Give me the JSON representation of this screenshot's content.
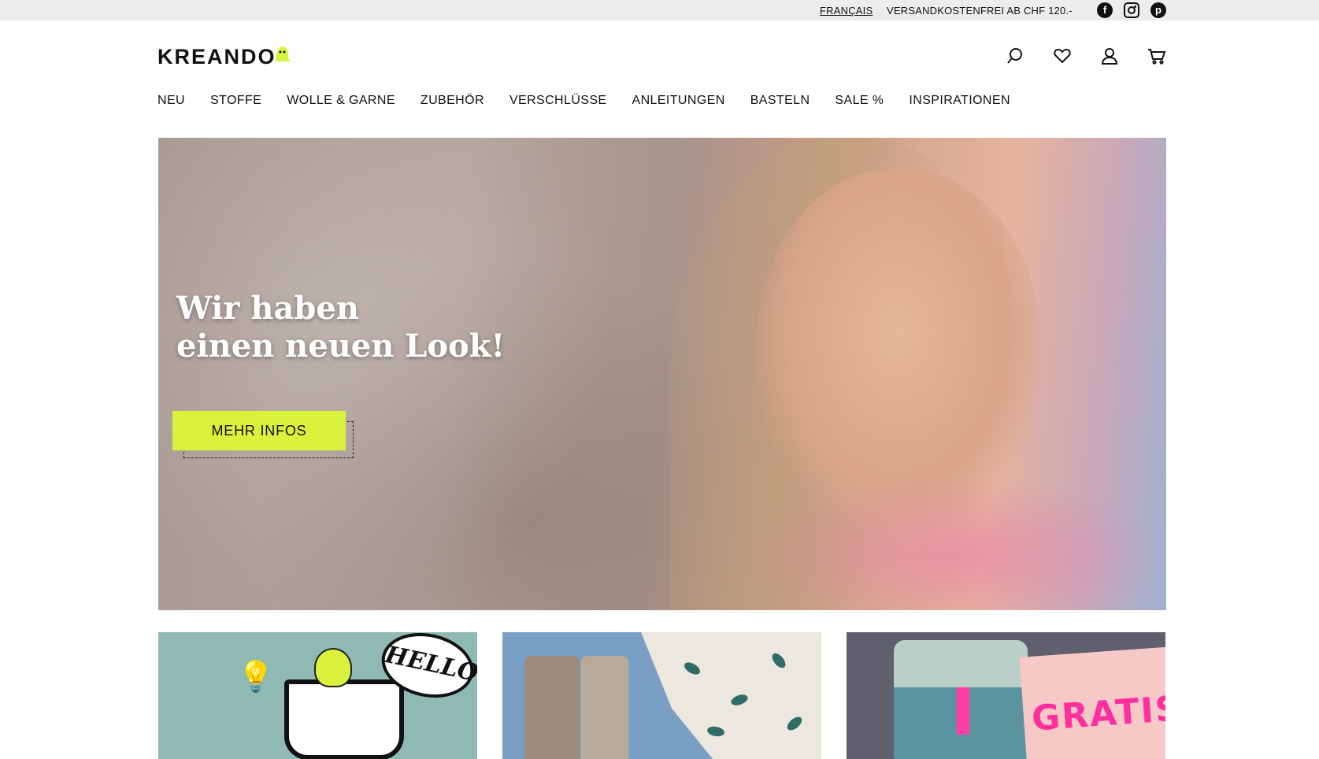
{
  "topbar": {
    "language_link": "FRANÇAIS",
    "shipping_notice": "VERSANDKOSTENFREI AB CHF 120.-",
    "social_icons": [
      "facebook-icon",
      "instagram-icon",
      "pinterest-icon"
    ]
  },
  "header": {
    "logo_text": "KREANDO",
    "icons": [
      "search-icon",
      "heart-icon",
      "user-icon",
      "cart-icon"
    ]
  },
  "nav": {
    "items": [
      {
        "label": "NEU"
      },
      {
        "label": "STOFFE"
      },
      {
        "label": "WOLLE & GARNE"
      },
      {
        "label": "ZUBEHÖR"
      },
      {
        "label": "VERSCHLÜSSE"
      },
      {
        "label": "ANLEITUNGEN"
      },
      {
        "label": "BASTELN"
      },
      {
        "label": "SALE %"
      },
      {
        "label": "INSPIRATIONEN"
      }
    ]
  },
  "hero": {
    "title_line1": "Wir haben",
    "title_line2": "einen neuen Look!",
    "cta_label": "MEHR INFOS"
  },
  "tiles": {
    "tile1": {
      "bubble_text": "HELLO"
    },
    "tile3": {
      "note_text": "GRATIS"
    }
  },
  "colors": {
    "accent": "#d9f23b",
    "topbar_bg": "#ededed",
    "text": "#111111"
  }
}
